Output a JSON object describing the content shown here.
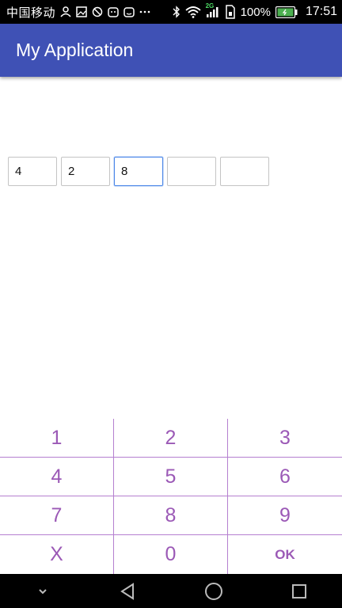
{
  "status_bar": {
    "carrier": "中国移动",
    "battery_percent": "100%",
    "time": "17:51",
    "network_type": "2G",
    "icons": [
      "person-icon",
      "image-icon",
      "blocked-icon",
      "android-icon",
      "cat-icon",
      "more-icon",
      "bluetooth-icon",
      "wifi-icon",
      "signal-icon",
      "sim-icon",
      "battery-icon"
    ]
  },
  "app_bar": {
    "title": "My Application",
    "color": "#3f51b5"
  },
  "code_inputs": [
    {
      "value": "4",
      "focused": false
    },
    {
      "value": "2",
      "focused": false
    },
    {
      "value": "8",
      "focused": true
    },
    {
      "value": "",
      "focused": false
    },
    {
      "value": "",
      "focused": false
    }
  ],
  "keypad": {
    "keys": [
      "1",
      "2",
      "3",
      "4",
      "5",
      "6",
      "7",
      "8",
      "9",
      "X",
      "0",
      "OK"
    ],
    "accent_color": "#9b59b6"
  },
  "nav_bar": {
    "icons": [
      "hide-keyboard-icon",
      "back-icon",
      "home-icon",
      "recents-icon"
    ]
  }
}
